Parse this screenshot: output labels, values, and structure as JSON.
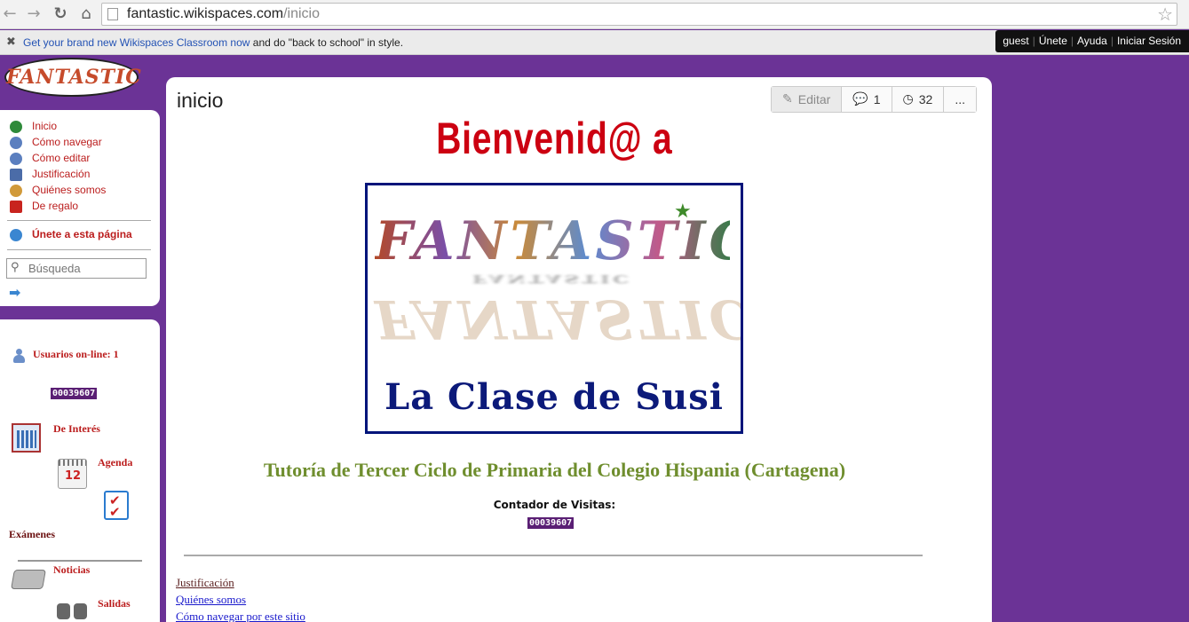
{
  "browser": {
    "url_host": "fantastic.wikispaces.com",
    "url_path": "/inicio"
  },
  "notice": {
    "link_text": "Get your brand new Wikispaces Classroom now",
    "rest_text": " and do \"back to school\" in style."
  },
  "user_bar": {
    "guest": "guest",
    "join": "Únete",
    "help": "Ayuda",
    "login": "Iniciar Sesión"
  },
  "logo": {
    "text": "FANTASTIC"
  },
  "sidebar": {
    "items": [
      {
        "label": "Inicio",
        "icon": "home-icon"
      },
      {
        "label": "Cómo navegar",
        "icon": "help-icon"
      },
      {
        "label": "Cómo editar",
        "icon": "help-icon"
      },
      {
        "label": "Justificación",
        "icon": "book-icon"
      },
      {
        "label": "Quiénes somos",
        "icon": "people-icon"
      },
      {
        "label": "De regalo",
        "icon": "gift-icon"
      }
    ],
    "join_page": "Únete a esta página",
    "search_placeholder": "Búsqueda"
  },
  "sidebar2": {
    "online": "Usuarios on-line: 1",
    "counter": "00039607",
    "de_interes": "De Interés",
    "agenda": "Agenda",
    "agenda_day": "12",
    "examenes": "Exámenes",
    "noticias": "Noticias",
    "salidas": "Salidas"
  },
  "main": {
    "title": "inicio",
    "toolbar": {
      "edit": "Editar",
      "comments": "1",
      "history": "32",
      "more": "..."
    },
    "welcome": "Bienvenid@ a",
    "banner_word": "FANTASTIC",
    "banner_subtitle": "La Clase de Susi",
    "tutoria": "Tutoría de Tercer Ciclo de Primaria del Colegio Hispania (Cartagena)",
    "visit_counter_label": "Contador de Visitas:",
    "visit_counter": "00039607",
    "links": [
      {
        "label": "Justificación",
        "color": "#5a1f1f"
      },
      {
        "label": "Quiénes somos",
        "color": "#1a1acc"
      },
      {
        "label": "Cómo navegar por este sitio",
        "color": "#1a1acc"
      }
    ]
  },
  "colors": {
    "background": "#6b3396",
    "nav_link": "#bb1d1d",
    "welcome": "#cc0011",
    "tutoria": "#6f8e2e",
    "banner_border": "#00147a"
  }
}
